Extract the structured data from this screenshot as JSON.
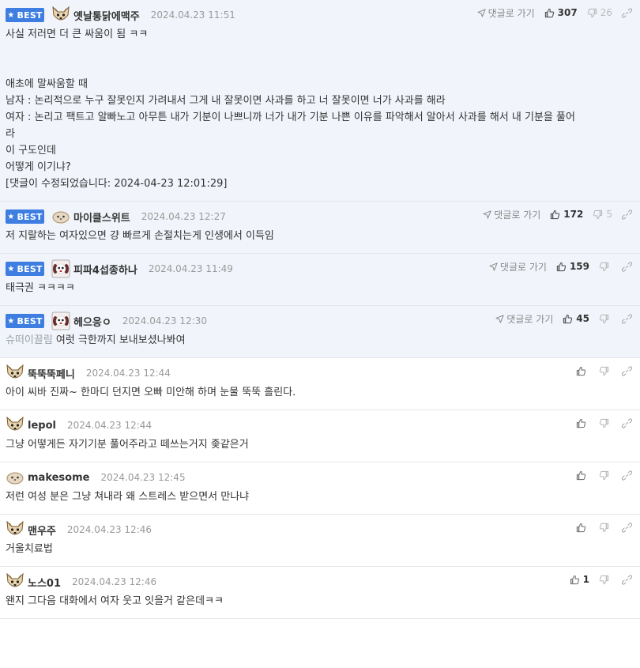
{
  "labels": {
    "best_badge": "BEST",
    "reply_link": "댓글로 가기"
  },
  "colors": {
    "best_background": "#f1f5fb",
    "badge_blue": "#3d7ee0"
  },
  "best_comments": [
    {
      "avatar": "fox-avatar-icon",
      "nickname": "옛날통닭에맥주",
      "date": "2024.04.23 11:51",
      "likes": "307",
      "dislikes": "26",
      "tag": "",
      "lines": [
        "사실 저러면 더 큰 싸움이 됨 ㅋㅋ",
        "",
        "",
        "애초에 말싸움할 때",
        "남자 : 논리적으로 누구 잘못인지 가려내서 그게 내 잘못이면 사과를 하고 너 잘못이면 너가 사과를 해라",
        "여자 : 논리고 팩트고 알빠노고 아무튼 내가 기분이 나쁘니까 너가 내가 기분 나쁜 이유를 파악해서 알아서 사과를 해서 내 기분을 풀어",
        "라",
        "이 구도인데",
        "어떻게 이기냐?",
        "[댓글이 수정되었습니다: 2024-04-23 12:01:29]"
      ]
    },
    {
      "avatar": "blob-avatar-icon",
      "nickname": "마이클스위트",
      "date": "2024.04.23 12:27",
      "likes": "172",
      "dislikes": "5",
      "tag": "",
      "lines": [
        "저 지랄하는 여자있으면 걍 빠르게 손절치는게 인생에서 이득임"
      ]
    },
    {
      "avatar": "dog-avatar-icon",
      "nickname": "피파4섭종하나",
      "date": "2024.04.23 11:49",
      "likes": "159",
      "dislikes": "",
      "tag": "",
      "lines": [
        "태극권 ㅋㅋㅋㅋ"
      ]
    },
    {
      "avatar": "dog-avatar-icon",
      "nickname": "헤으응ㅇ",
      "date": "2024.04.23 12:30",
      "likes": "45",
      "dislikes": "",
      "tag": "슈떠이끌림",
      "lines": [
        "여럿 극한까지 보내보셨나봐여"
      ]
    }
  ],
  "comments": [
    {
      "avatar": "fox-avatar-icon",
      "nickname": "뚝뚝뚝페니",
      "date": "2024.04.23 12:44",
      "likes": "",
      "dislikes": "",
      "lines": [
        "아이 씨바 진짜~ 한마디 던지면 오빠 미안해 하며 눈물 뚝뚝 흘린다."
      ]
    },
    {
      "avatar": "fox-avatar-icon",
      "nickname": "lepol",
      "date": "2024.04.23 12:44",
      "likes": "",
      "dislikes": "",
      "lines": [
        "그냥 어떻게든 자기기분 풀어주라고 떼쓰는거지 좆같은거"
      ]
    },
    {
      "avatar": "blob-avatar-icon",
      "nickname": "makesome",
      "date": "2024.04.23 12:45",
      "likes": "",
      "dislikes": "",
      "lines": [
        "저런 여성 분은 그냥 쳐내라 왜 스트레스 받으면서 만나냐"
      ]
    },
    {
      "avatar": "fox-avatar-icon",
      "nickname": "맨우주",
      "date": "2024.04.23 12:46",
      "likes": "",
      "dislikes": "",
      "lines": [
        "거울치료법"
      ]
    },
    {
      "avatar": "fox-avatar-icon",
      "nickname": "노스01",
      "date": "2024.04.23 12:46",
      "likes": "1",
      "dislikes": "",
      "lines": [
        "왠지 그다음 대화에서 여자 웃고 잇을거 같은데ㅋㅋ"
      ]
    }
  ]
}
